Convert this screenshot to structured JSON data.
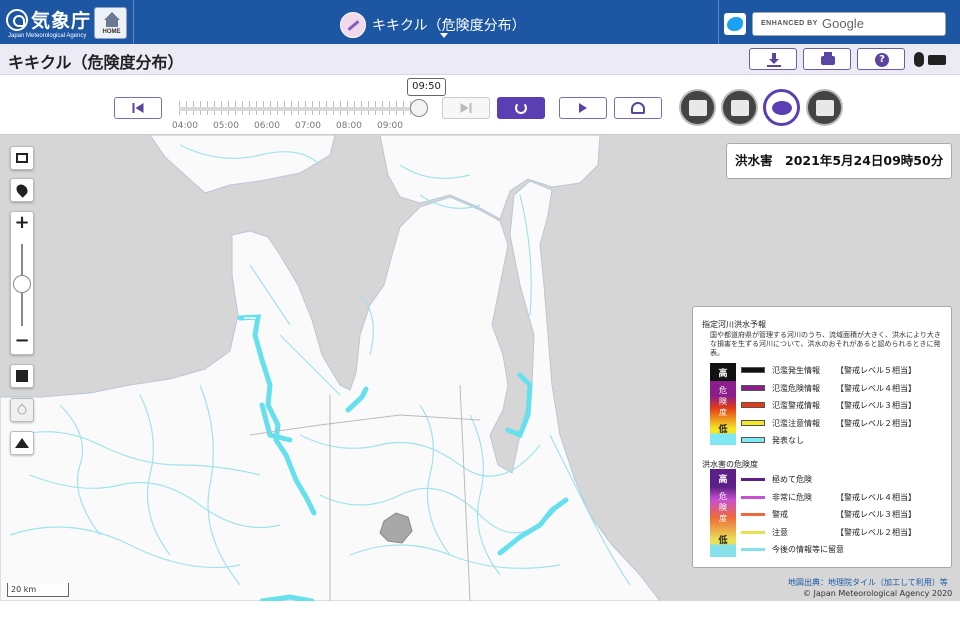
{
  "header": {
    "logo_text": "気象庁",
    "logo_sub": "Japan Meteorological Agency",
    "home_label": "HOME",
    "app_title": "キキクル（危険度分布）",
    "search_enhanced": "ENHANCED BY",
    "search_google": "Google",
    "accent_color": "#1d56a3"
  },
  "titlebar": {
    "title": "キキクル（危険度分布）",
    "tools": [
      "download-icon",
      "print-icon",
      "help-icon",
      "mouse-keyboard-icon"
    ]
  },
  "timeline": {
    "current_time": "09:50",
    "ticks": [
      "04:00",
      "05:00",
      "06:00",
      "07:00",
      "08:00",
      "09:00"
    ],
    "progress": 0.97,
    "layers": [
      "landslide-icon",
      "inundation-icon",
      "flood-icon",
      "map-icon"
    ],
    "active_layer": "flood-icon"
  },
  "info": {
    "type": "洪水害",
    "datetime": "2021年5月24日09時50分"
  },
  "legend": {
    "section1_title": "指定河川洪水予報",
    "section1_desc": "国や都道府県が管理する河川のうち、流域面積が大きく、洪水により大きな損害を生ずる河川について、洪水のおそれがあると認められるときに発表。",
    "high": "高",
    "low": "低",
    "danger_col": [
      "危",
      "険",
      "度"
    ],
    "section1_items": [
      {
        "label": "氾濫発生情報",
        "level": "【警戒レベル５相当】",
        "color": "#111111"
      },
      {
        "label": "氾濫危険情報",
        "level": "【警戒レベル４相当】",
        "color": "#8a1e8c"
      },
      {
        "label": "氾濫警戒情報",
        "level": "【警戒レベル３相当】",
        "color": "#e53a16"
      },
      {
        "label": "氾濫注意情報",
        "level": "【警戒レベル２相当】",
        "color": "#f4e626"
      },
      {
        "label": "発表なし",
        "level": "",
        "color": "#7fe8f0"
      }
    ],
    "section2_title": "洪水害の危険度",
    "section2_items": [
      {
        "label": "極めて危険",
        "level": "",
        "color": "#5b1f86"
      },
      {
        "label": "非常に危険",
        "level": "【警戒レベル４相当】",
        "color": "#c650d0"
      },
      {
        "label": "警戒",
        "level": "【警戒レベル３相当】",
        "color": "#ef6a3a"
      },
      {
        "label": "注意",
        "level": "【警戒レベル２相当】",
        "color": "#e8df55"
      },
      {
        "label": "今後の情報等に留意",
        "level": "",
        "color": "#86e2ea"
      }
    ]
  },
  "map": {
    "scale": "20 km",
    "attribution": "地図出典：地理院タイル（加工して利用）等",
    "copyright": "© Japan Meteorological Agency 2020",
    "controls": [
      "fullscreen-icon",
      "location-pin-icon",
      "zoom-in",
      "zoom-out",
      "map-type-icon",
      "drop-icon",
      "terrain-icon"
    ],
    "zoom_plus": "+",
    "zoom_minus": "−"
  }
}
